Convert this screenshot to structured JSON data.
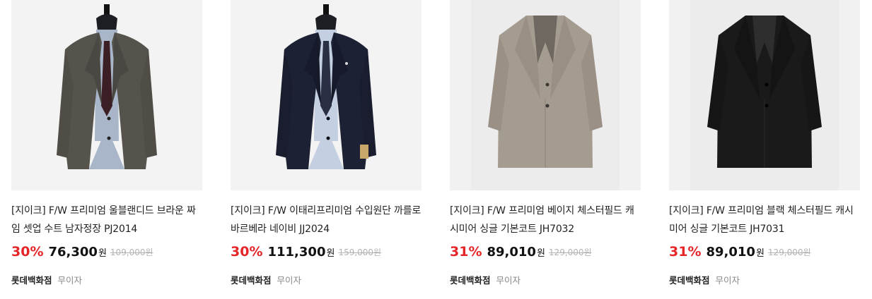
{
  "products": [
    {
      "title": "[지이크] F/W 프리미엄 울블랜디드 브라운 짜임 셋업 수트 남자정장 PJ2014",
      "discount": "30%",
      "sale_price": "76,300",
      "currency": "원",
      "original_price": "109,000원",
      "store": "롯데백화점",
      "shipping": "무이자",
      "image_icon": "brown-check-suit-jacket"
    },
    {
      "title": "[지이크] F/W 이태리프리미엄 수입원단 까를로바르베라 네이비 JJ2024",
      "discount": "30%",
      "sale_price": "111,300",
      "currency": "원",
      "original_price": "159,000원",
      "store": "롯데백화점",
      "shipping": "무이자",
      "image_icon": "navy-suit-jacket"
    },
    {
      "title": "[지이크] F/W 프리미엄 베이지 체스터필드 캐시미어 싱글 기본코트 JH7032",
      "discount": "31%",
      "sale_price": "89,010",
      "currency": "원",
      "original_price": "129,000원",
      "store": "롯데백화점",
      "shipping": "무이자",
      "image_icon": "beige-chesterfield-coat"
    },
    {
      "title": "[지이크] F/W 프리미엄 블랙 체스터필드 캐시미어 싱글 기본코트 JH7031",
      "discount": "31%",
      "sale_price": "89,010",
      "currency": "원",
      "original_price": "129,000원",
      "store": "롯데백화점",
      "shipping": "무이자",
      "image_icon": "black-chesterfield-coat"
    }
  ],
  "colors": {
    "discount": "#e52528",
    "original_price": "#b3b3b3",
    "thumb_bg": "#f3f3f3",
    "suit_brown": "#54524a",
    "suit_navy": "#1c2133",
    "coat_beige": "#a59c91",
    "coat_black": "#1a1a1a"
  }
}
